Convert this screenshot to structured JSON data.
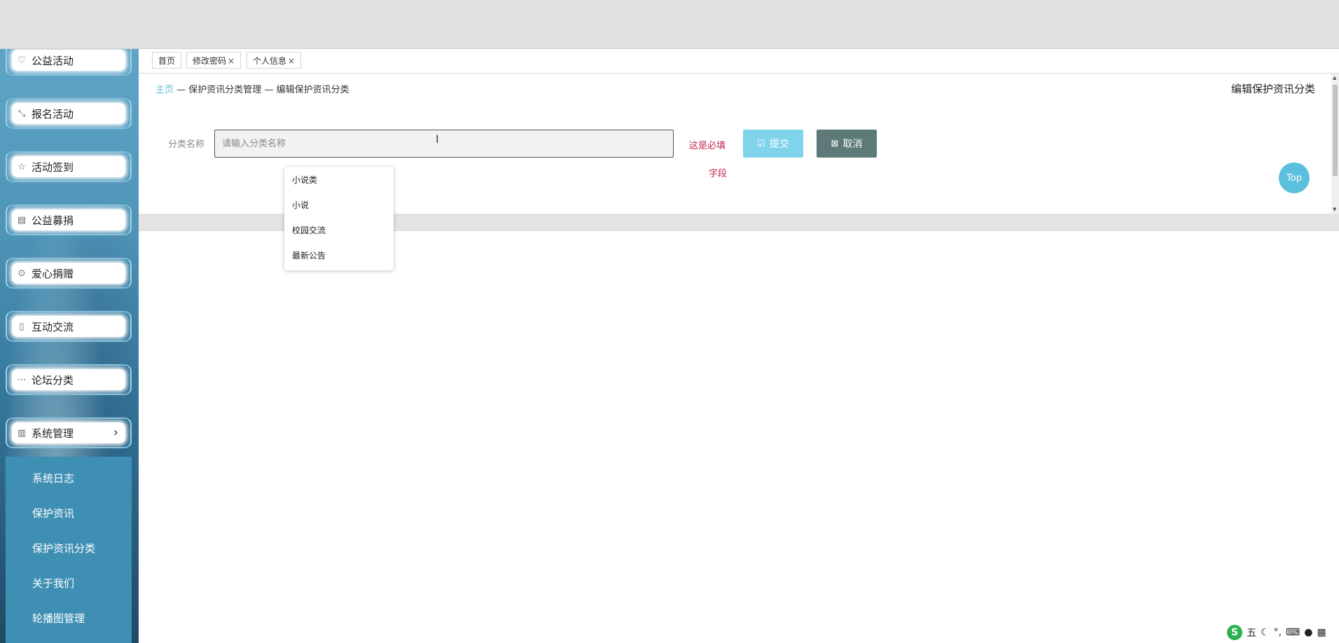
{
  "sidebar": {
    "menu_items": [
      {
        "label": "公益活动",
        "icon": "heart-icon"
      },
      {
        "label": "报名活动",
        "icon": "compress-icon"
      },
      {
        "label": "活动签到",
        "icon": "star-icon"
      },
      {
        "label": "公益募捐",
        "icon": "chart-icon"
      },
      {
        "label": "爱心捐赠",
        "icon": "target-icon"
      },
      {
        "label": "互动交流",
        "icon": "bookmark-icon"
      },
      {
        "label": "论坛分类",
        "icon": "chat-icon"
      },
      {
        "label": "系统管理",
        "icon": "bar-chart-icon",
        "expanded": true
      }
    ],
    "submenu": [
      "系统日志",
      "保护资讯",
      "保护资讯分类",
      "关于我们",
      "轮播图管理"
    ]
  },
  "tabs": [
    {
      "label": "首页",
      "closable": false
    },
    {
      "label": "修改密码",
      "closable": true
    },
    {
      "label": "个人信息",
      "closable": true
    }
  ],
  "breadcrumb": {
    "home": "主页",
    "separator": "—",
    "level1": "保护资讯分类管理",
    "level2": "编辑保护资讯分类"
  },
  "page_title": "编辑保护资讯分类",
  "form": {
    "label": "分类名称",
    "placeholder": "请输入分类名称",
    "value": "",
    "required_line1": "这是必填",
    "required_line2": "字段"
  },
  "buttons": {
    "submit": "提交",
    "cancel": "取消"
  },
  "top_button": "Top",
  "autocomplete": [
    "小说类",
    "小说",
    "校园交流",
    "最新公告"
  ],
  "ime": {
    "mode": "五"
  },
  "colors": {
    "accent": "#5bc0de",
    "submit": "#7fd3ea",
    "cancel": "#5d7a78",
    "required": "#c7254e",
    "submenu_bg": "#3f8fb4"
  }
}
